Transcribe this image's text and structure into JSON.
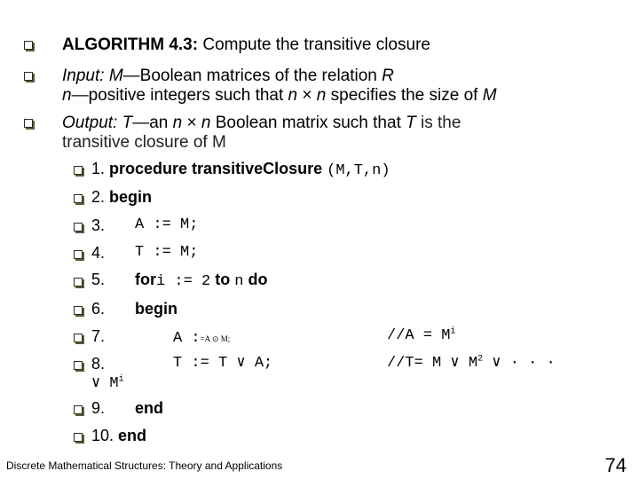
{
  "header": {
    "algorithm_label": "ALGORITHM 4.3:",
    "algorithm_desc": " Compute the transitive closure"
  },
  "input": {
    "label": "Input:",
    "var_m": "M",
    "desc1": "Boolean matrices of the relation ",
    "var_r": "R",
    "var_n": "n",
    "desc2": "positive integers such that ",
    "n1": "n",
    "times": " × ",
    "n2": "n",
    "desc3": " specifies the size of ",
    "var_m2": "M"
  },
  "output": {
    "label": "Output:",
    "var_t": "T",
    "desc1": "an ",
    "n1": "n",
    "times": " × ",
    "n2": "n",
    "desc2": " Boolean matrix such that ",
    "var_t2": "T",
    "desc3": " is the",
    "line2": "transitive closure of M"
  },
  "code": {
    "line1": {
      "num": "1.",
      "kw": "procedure transitiveClosure",
      "args": "(M,T,n)"
    },
    "line2": {
      "num": "2.",
      "kw": "begin"
    },
    "line3": {
      "num": "3.",
      "code": "A := M;"
    },
    "line4": {
      "num": "4.",
      "code": "T := M;"
    },
    "line5": {
      "num": "5.",
      "kw_for": "for",
      "var_i": "i := 2",
      "kw_to": "to",
      "var_n": "n",
      "kw_do": "do"
    },
    "line6": {
      "num": "6.",
      "kw": "begin"
    },
    "line7": {
      "num": "7.",
      "lhs": "A :",
      "rhs": "=A ⊙ M;",
      "comment": "//A = M",
      "comment_sup": "i"
    },
    "line8": {
      "num": "8.",
      "code": "T := T ∨ A;",
      "comment": "//T= M ∨ M",
      "comment_sup": "2",
      "comment_rest": " ∨ · · ·",
      "wrap": "∨ M",
      "wrap_sup": "i"
    },
    "line9": {
      "num": "9.",
      "kw": "end"
    },
    "line10": {
      "num": "10.",
      "kw": "end"
    }
  },
  "footer": {
    "book_title": "Discrete Mathematical Structures: Theory and Applications",
    "page_number": "74"
  }
}
